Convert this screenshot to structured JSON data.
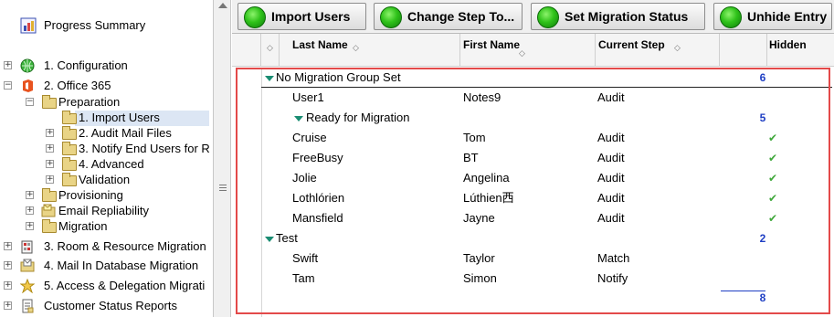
{
  "tree": {
    "progress_summary": "Progress Summary",
    "items": [
      {
        "label": "1. Configuration"
      },
      {
        "label": "2. Office 365"
      },
      {
        "label": "Preparation"
      },
      {
        "label": "1. Import Users"
      },
      {
        "label": "2. Audit Mail Files"
      },
      {
        "label": "3. Notify End Users for R"
      },
      {
        "label": "4. Advanced"
      },
      {
        "label": "Validation"
      },
      {
        "label": "Provisioning"
      },
      {
        "label": "Email Repliability"
      },
      {
        "label": "Migration"
      },
      {
        "label": "3. Room & Resource Migration"
      },
      {
        "label": "4. Mail In Database Migration"
      },
      {
        "label": "5. Access & Delegation Migrati"
      },
      {
        "label": "Customer Status Reports"
      }
    ]
  },
  "toolbar": {
    "import_users": "Import Users",
    "change_step": "Change Step To...",
    "set_migration_status": "Set Migration Status",
    "unhide_entry": "Unhide Entry"
  },
  "grid": {
    "headers": {
      "last_name": "Last Name",
      "first_name": "First Name",
      "current_step": "Current Step",
      "hidden": "Hidden"
    },
    "group1": {
      "label": "No Migration Group Set",
      "count": "6"
    },
    "row_user1": {
      "last": "User1",
      "first": "Notes9",
      "step": "Audit"
    },
    "subgroup": {
      "label": "Ready for Migration",
      "count": "5"
    },
    "rows_ready": [
      {
        "last": "Cruise",
        "first": "Tom",
        "step": "Audit",
        "check": "✔"
      },
      {
        "last": "FreeBusy",
        "first": "BT",
        "step": "Audit",
        "check": "✔"
      },
      {
        "last": "Jolie",
        "first": "Angelina",
        "step": "Audit",
        "check": "✔"
      },
      {
        "last": "Lothlórien",
        "first": "Lúthien西",
        "step": "Audit",
        "check": "✔"
      },
      {
        "last": "Mansfield",
        "first": "Jayne",
        "step": "Audit",
        "check": "✔"
      }
    ],
    "group2": {
      "label": "Test",
      "count": "2"
    },
    "rows_test": [
      {
        "last": "Swift",
        "first": "Taylor",
        "step": "Match"
      },
      {
        "last": "Tam",
        "first": "Simon",
        "step": "Notify"
      }
    ],
    "total": "8"
  }
}
